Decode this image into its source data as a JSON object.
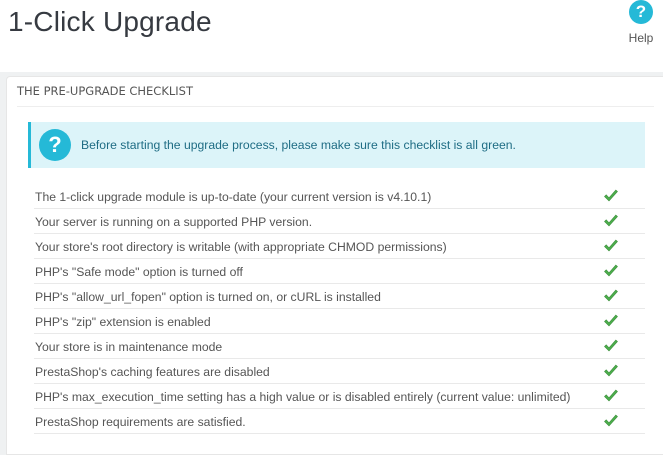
{
  "header": {
    "title": "1-Click Upgrade",
    "help_label": "Help",
    "help_icon": "question-circle-icon"
  },
  "panel": {
    "heading": "THE PRE-UPGRADE CHECKLIST",
    "info": {
      "icon": "question-circle-icon",
      "text": "Before starting the upgrade process, please make sure this checklist is all green."
    },
    "items": [
      {
        "label": "The 1-click upgrade module is up-to-date (your current version is v4.10.1)",
        "status": "ok"
      },
      {
        "label": "Your server is running on a supported PHP version.",
        "status": "ok"
      },
      {
        "label": "Your store's root directory is writable (with appropriate CHMOD permissions)",
        "status": "ok"
      },
      {
        "label": "PHP's \"Safe mode\" option is turned off",
        "status": "ok"
      },
      {
        "label": "PHP's \"allow_url_fopen\" option is turned on, or cURL is installed",
        "status": "ok"
      },
      {
        "label": "PHP's \"zip\" extension is enabled",
        "status": "ok"
      },
      {
        "label": "Your store is in maintenance mode",
        "status": "ok"
      },
      {
        "label": "PrestaShop's caching features are disabled",
        "status": "ok"
      },
      {
        "label": "PHP's max_execution_time setting has a high value or is disabled entirely (current value: unlimited)",
        "status": "ok"
      },
      {
        "label": "PrestaShop requirements are satisfied.",
        "status": "ok"
      }
    ]
  },
  "colors": {
    "accent": "#25b9d7",
    "check_green": "#4cae4c",
    "info_bg": "#dcf4f9"
  }
}
